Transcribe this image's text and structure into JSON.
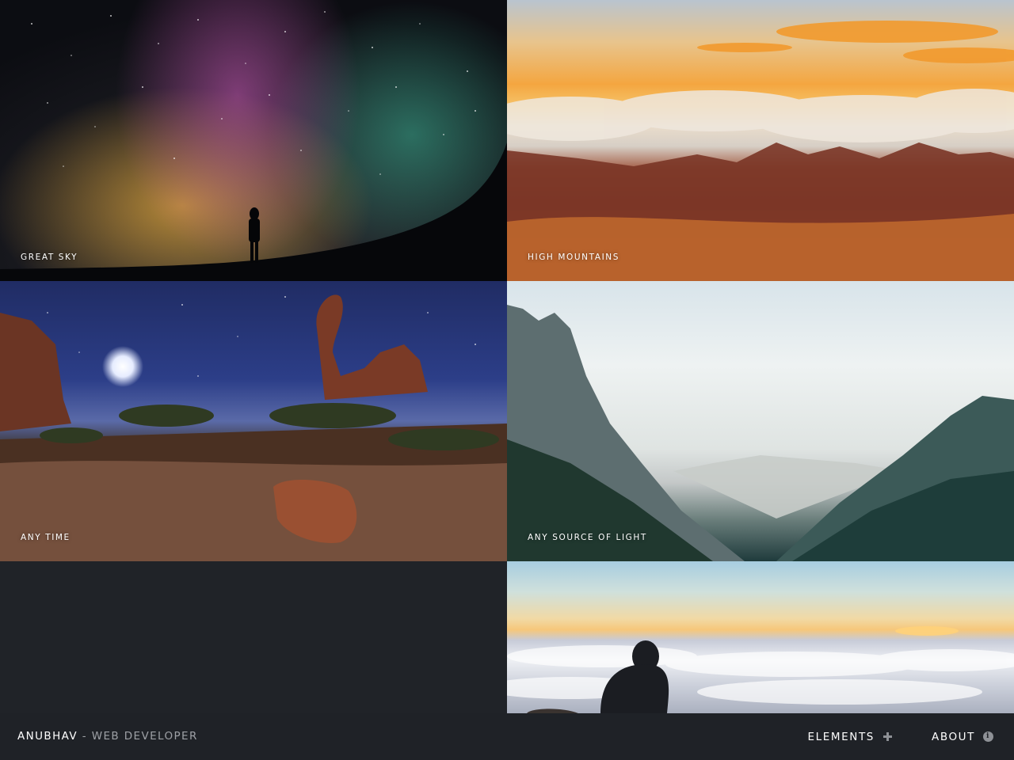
{
  "gallery": {
    "items": [
      {
        "caption": "GREAT SKY"
      },
      {
        "caption": "HIGH MOUNTAINS"
      },
      {
        "caption": "ANY TIME"
      },
      {
        "caption": "ANY SOURCE OF LIGHT"
      },
      {
        "caption": ""
      }
    ]
  },
  "footer": {
    "brand_name": "ANUBHAV",
    "brand_separator": " - ",
    "brand_role": "WEB DEVELOPER",
    "nav": [
      {
        "label": "ELEMENTS",
        "icon": "plus-icon"
      },
      {
        "label": "ABOUT",
        "icon": "info-icon"
      }
    ]
  },
  "colors": {
    "footer_background": "#1f2227",
    "page_background": "#202328",
    "brand_text": "#ffffff",
    "muted_text": "#9ea1a6",
    "icon_gray": "#8e9196"
  }
}
